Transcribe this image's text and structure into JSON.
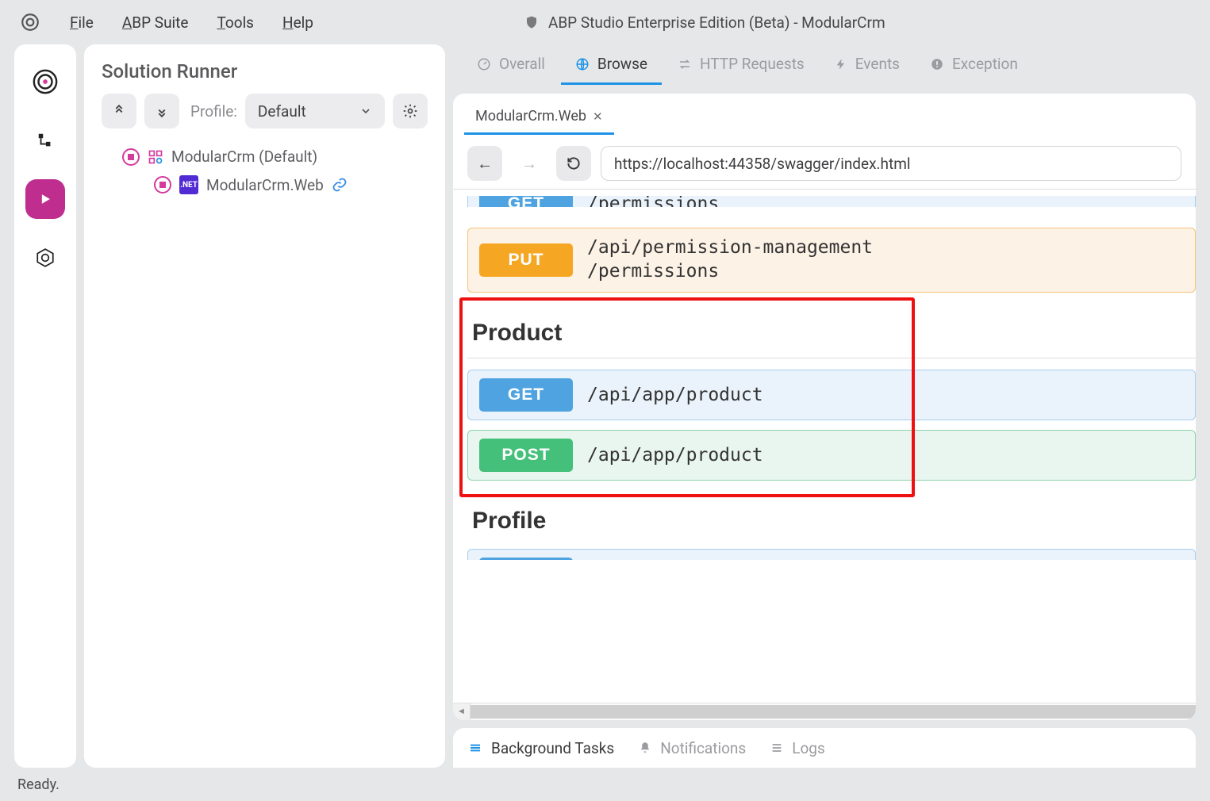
{
  "menubar": {
    "items": [
      "File",
      "ABP Suite",
      "Tools",
      "Help"
    ],
    "title": "ABP Studio Enterprise Edition (Beta) - ModularCrm"
  },
  "solution_runner": {
    "title": "Solution Runner",
    "profile_label": "Profile:",
    "profile_value": "Default",
    "tree": {
      "root": "ModularCrm (Default)",
      "child": "ModularCrm.Web"
    }
  },
  "tabs": {
    "items": [
      "Overall",
      "Browse",
      "HTTP Requests",
      "Events",
      "Exception"
    ],
    "active_index": 1
  },
  "inner_tab": "ModularCrm.Web",
  "url": "https://localhost:44358/swagger/index.html",
  "swagger": {
    "put": {
      "method": "PUT",
      "path": "/api/permission-management/permissions"
    },
    "section_product": "Product",
    "get": {
      "method": "GET",
      "path": "/api/app/product"
    },
    "post": {
      "method": "POST",
      "path": "/api/app/product"
    },
    "section_profile": "Profile"
  },
  "bottom": {
    "items": [
      "Background Tasks",
      "Notifications",
      "Logs"
    ]
  },
  "status": "Ready."
}
